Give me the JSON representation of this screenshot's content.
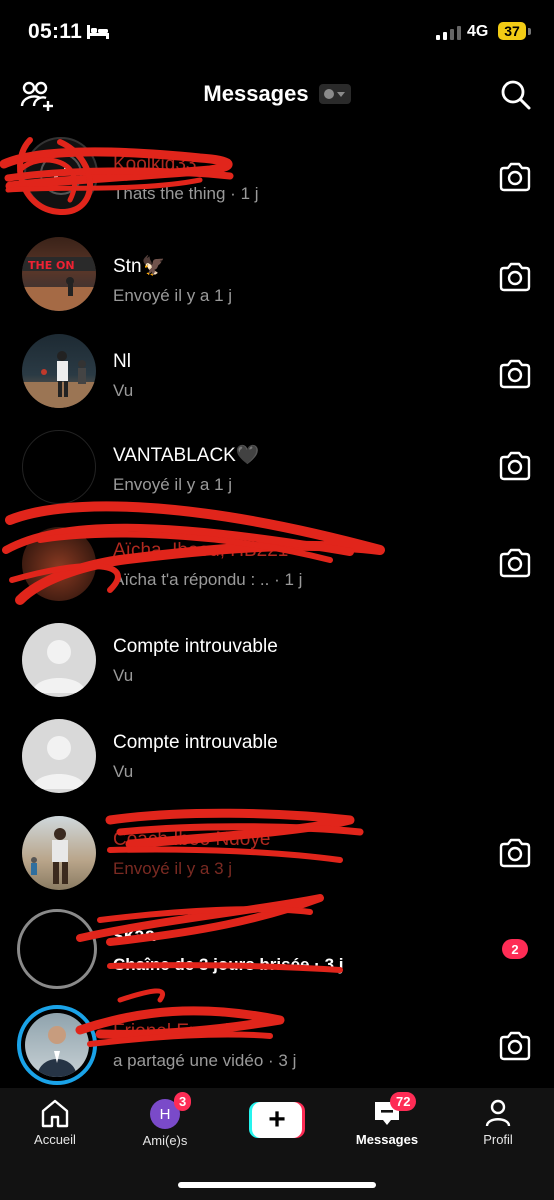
{
  "status_bar": {
    "time": "05:11",
    "network": "4G",
    "battery": "37"
  },
  "header": {
    "title": "Messages"
  },
  "conversations": [
    {
      "name": "Koolkid33",
      "sub": "Thats the thing · 1 j",
      "action": "camera-icon"
    },
    {
      "name": "Stn🦅",
      "sub": "Envoyé il y a 1 j",
      "action": "camera-icon"
    },
    {
      "name": "Nl",
      "sub": "Vu",
      "action": "camera-icon"
    },
    {
      "name": "VANTABLACK🖤",
      "sub": "Envoyé il y a 1 j",
      "action": "camera-icon"
    },
    {
      "name": "Aïcha, Iboou, HB221",
      "sub": "Aïcha t'a répondu : .. · 1 j",
      "action": "camera-icon"
    },
    {
      "name": "Compte introuvable",
      "sub": "Vu"
    },
    {
      "name": "Compte introuvable",
      "sub": "Vu"
    },
    {
      "name": "Coach Iboo Ndoye",
      "sub": "Envoyé il y a 3 j",
      "action": "camera-icon"
    },
    {
      "name": "skaa",
      "sub": "Chaîne de 3 jours brisée · 3 j",
      "unread": "2"
    },
    {
      "name": "Frionel Eressi",
      "sub": "a partagé une vidéo · 3 j",
      "action": "camera-icon"
    }
  ],
  "tabbar": {
    "home": "Accueil",
    "friends": "Ami(e)s",
    "friends_initial": "H",
    "friends_badge": "3",
    "create": "+",
    "messages": "Messages",
    "messages_badge": "72",
    "profile": "Profil"
  },
  "colors": {
    "accent": "#fe2c55",
    "cyan": "#25f4ee",
    "battery": "#f2cc15",
    "scribble": "#e1251b"
  }
}
